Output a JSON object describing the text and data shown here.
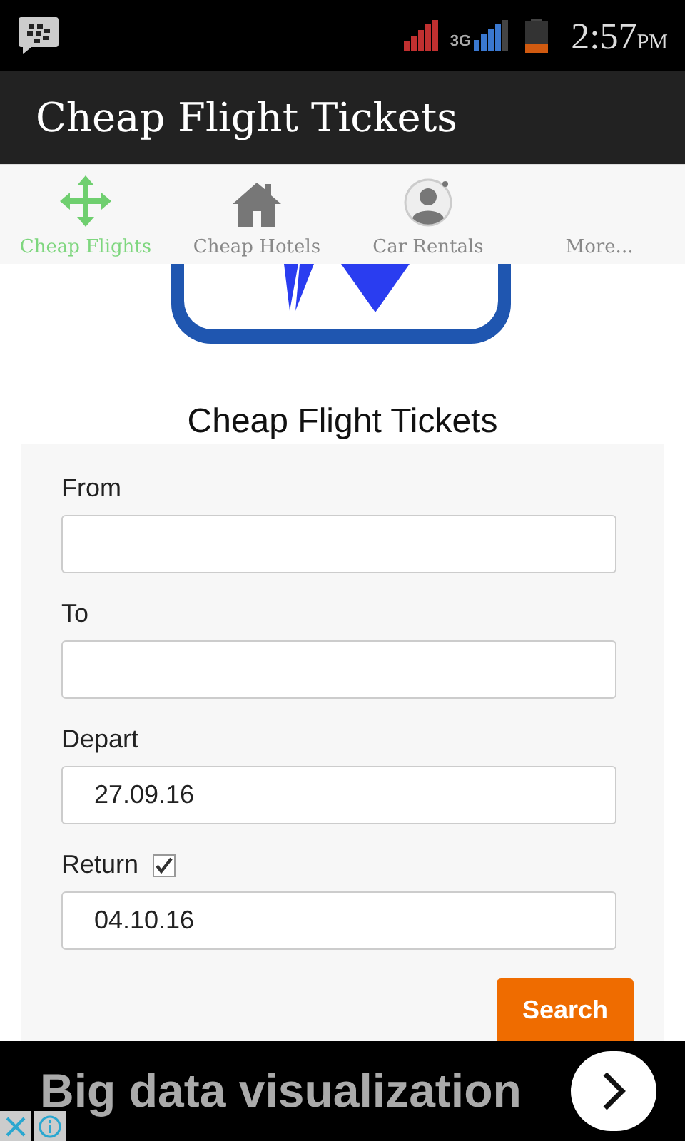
{
  "status_bar": {
    "time": "2:57",
    "ampm": "PM",
    "network": "3G"
  },
  "app_bar": {
    "title": "Cheap Flight Tickets"
  },
  "tabs": [
    {
      "label": "Cheap Flights",
      "kind": "arrows",
      "selected": true
    },
    {
      "label": "Cheap Hotels",
      "kind": "house",
      "selected": false
    },
    {
      "label": "Car Rentals",
      "kind": "person",
      "selected": false
    },
    {
      "label": "More...",
      "kind": "plain",
      "selected": false
    }
  ],
  "heading": "Cheap Flight Tickets",
  "form": {
    "fields": [
      {
        "label": "From"
      },
      {
        "label": "To"
      },
      {
        "label": "Depart",
        "value": "27.09.16"
      },
      {
        "label": "Return",
        "value": "04.10.16",
        "checked": true
      }
    ],
    "button": "Search"
  },
  "ad": {
    "text": "Big data visualization"
  }
}
